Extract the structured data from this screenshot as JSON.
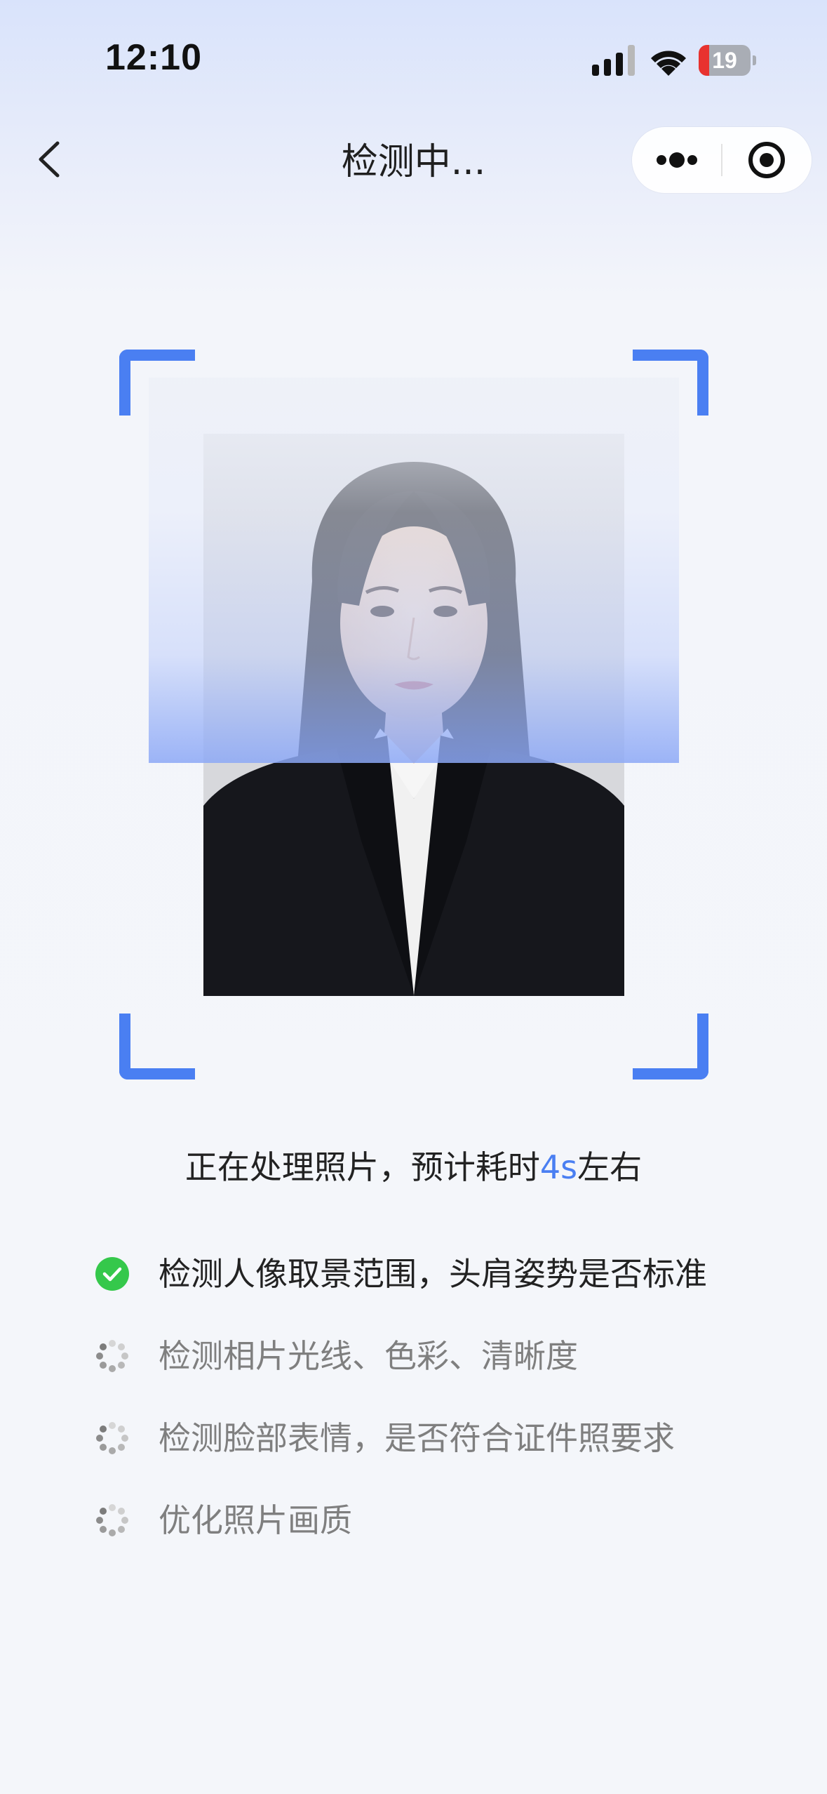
{
  "status_bar": {
    "time": "12:10",
    "battery_level": "19",
    "icons": [
      "signal-icon",
      "wifi-icon",
      "battery-icon"
    ]
  },
  "nav": {
    "back_icon": "chevron-left-icon",
    "title": "检测中...",
    "capsule_icons": [
      "more-dots-icon",
      "target-close-icon"
    ]
  },
  "scan": {
    "corner_color": "#4a7ff2",
    "image": "id-photo-portrait"
  },
  "processing": {
    "prefix": "正在处理照片，预计耗时",
    "time_value": "4s",
    "suffix": "左右",
    "accent_color": "#4a7ff2"
  },
  "steps": [
    {
      "label": "检测人像取景范围，头肩姿势是否标准",
      "status": "done",
      "icon": "check-circle-icon"
    },
    {
      "label": "检测相片光线、色彩、清晰度",
      "status": "pending",
      "icon": "spinner-icon"
    },
    {
      "label": "检测脸部表情，是否符合证件照要求",
      "status": "pending",
      "icon": "spinner-icon"
    },
    {
      "label": "优化照片画质",
      "status": "pending",
      "icon": "spinner-icon"
    }
  ]
}
